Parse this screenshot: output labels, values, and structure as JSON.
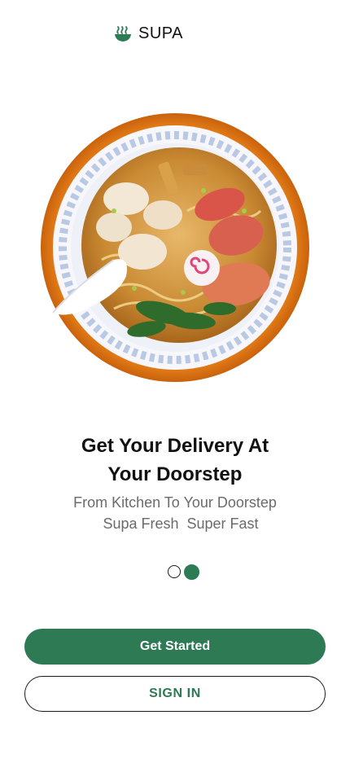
{
  "header": {
    "brand_name": "SUPA",
    "logo_icon": "ramen-bowl-icon"
  },
  "hero": {
    "image_subject": "ramen-bowl-illustration"
  },
  "onboarding": {
    "headline_line1": "Get Your Delivery At",
    "headline_line2": "Your Doorstep",
    "subtext_line1": "From Kitchen To Your Doorstep",
    "subtext_line2": "Supa Fresh  Super Fast",
    "pager": {
      "total_pages": 2,
      "current_page": 2
    }
  },
  "actions": {
    "primary_label": "Get Started",
    "secondary_label": "SIGN IN"
  },
  "colors": {
    "accent": "#2e7a55",
    "bowl_rim": "#e07a16",
    "headline_text": "#111111",
    "subtext": "#6b6b6b"
  }
}
